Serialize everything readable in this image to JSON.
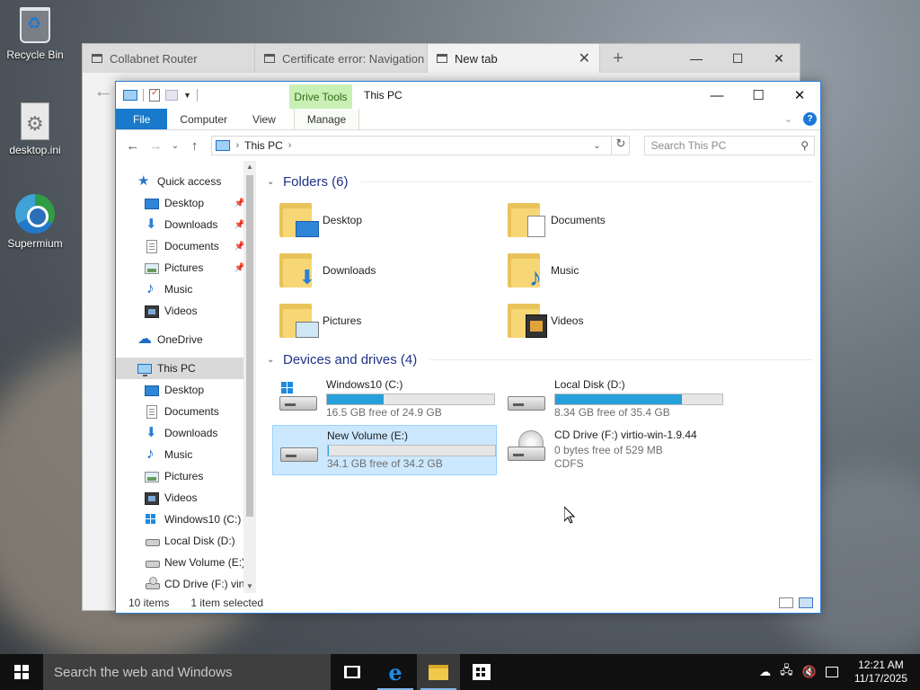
{
  "desktop": {
    "icons": [
      {
        "label": "Recycle Bin",
        "icon": "recycle-bin-icon"
      },
      {
        "label": "desktop.ini",
        "icon": "settings-file-icon"
      },
      {
        "label": "Supermium",
        "icon": "browser-icon"
      }
    ]
  },
  "browser": {
    "tabs": [
      {
        "label": "Collabnet Router"
      },
      {
        "label": "Certificate error: Navigation"
      },
      {
        "label": "New tab"
      }
    ]
  },
  "explorer": {
    "title": "This PC",
    "context_tab": "Drive Tools",
    "ribbon_tabs": [
      "File",
      "Computer",
      "View",
      "Manage"
    ],
    "address": {
      "crumb": "This PC"
    },
    "search_placeholder": "Search This PC",
    "nav": {
      "quick_access": "Quick access",
      "quick_items": [
        "Desktop",
        "Downloads",
        "Documents",
        "Pictures",
        "Music",
        "Videos"
      ],
      "onedrive": "OneDrive",
      "this_pc": "This PC",
      "pc_items": [
        "Desktop",
        "Documents",
        "Downloads",
        "Music",
        "Pictures",
        "Videos",
        "Windows10 (C:)",
        "Local Disk (D:)",
        "New Volume (E:)",
        "CD Drive (F:) virt"
      ]
    },
    "folders_header": "Folders (6)",
    "folders": [
      "Desktop",
      "Documents",
      "Downloads",
      "Music",
      "Pictures",
      "Videos"
    ],
    "drives_header": "Devices and drives (4)",
    "drives": [
      {
        "name": "Windows10 (C:)",
        "free": "16.5 GB free of 24.9 GB",
        "used_fraction": 0.34
      },
      {
        "name": "Local Disk (D:)",
        "free": "8.34 GB free of 35.4 GB",
        "used_fraction": 0.76
      },
      {
        "name": "New Volume (E:)",
        "free": "34.1 GB free of 34.2 GB",
        "used_fraction": 0.003
      },
      {
        "name": "CD Drive (F:) virtio-win-1.9.44",
        "free": "0 bytes free of 529 MB",
        "fs": "CDFS"
      }
    ],
    "status": {
      "items": "10 items",
      "selected": "1 item selected"
    }
  },
  "taskbar": {
    "search_placeholder": "Search the web and Windows",
    "time": "12:21 AM",
    "date": "11/17/2025"
  },
  "colors": {
    "accent": "#1979ca",
    "drive_bar": "#26a0da",
    "selection": "#cce8ff",
    "context_tab": "#c9f0b4"
  }
}
